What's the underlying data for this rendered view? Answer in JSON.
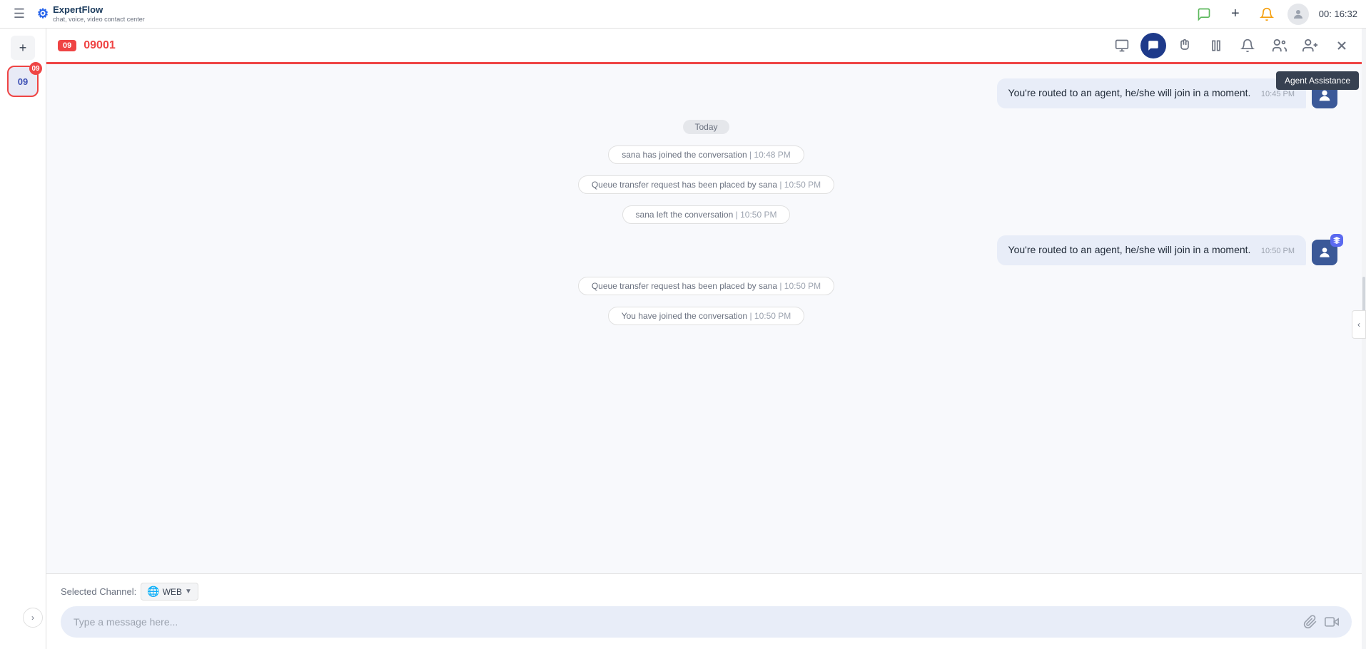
{
  "app": {
    "name": "ExpertFlow",
    "subtitle": "chat, voice, video contact center",
    "timer": "00: 16:32"
  },
  "header": {
    "chat_id_badge": "09",
    "chat_id": "09001"
  },
  "messages": [
    {
      "type": "agent_outgoing",
      "text": "You're routed to an agent, he/she will join in a moment.",
      "time": "10:45 PM",
      "above_today": true
    },
    {
      "type": "date_divider",
      "label": "Today"
    },
    {
      "type": "system",
      "text": "sana has joined the conversation",
      "time": "10:48 PM"
    },
    {
      "type": "system",
      "text": "Queue transfer request has been placed by sana",
      "time": "10:50 PM"
    },
    {
      "type": "system",
      "text": "sana left the conversation",
      "time": "10:50 PM"
    },
    {
      "type": "agent_outgoing",
      "text": "You're routed to an agent, he/she will join in a moment.",
      "time": "10:50 PM"
    },
    {
      "type": "system",
      "text": "Queue transfer request has been placed by sana",
      "time": "10:50 PM"
    },
    {
      "type": "system",
      "text": "You have joined the conversation",
      "time": "10:50 PM"
    }
  ],
  "input": {
    "placeholder": "Type a message here..."
  },
  "channel": {
    "label": "Selected Channel:",
    "icon": "🌐",
    "name": "WEB"
  },
  "tooltip": {
    "text": "Agent Assistance"
  },
  "sidebar": {
    "badge": "09",
    "conv_label": "09"
  }
}
